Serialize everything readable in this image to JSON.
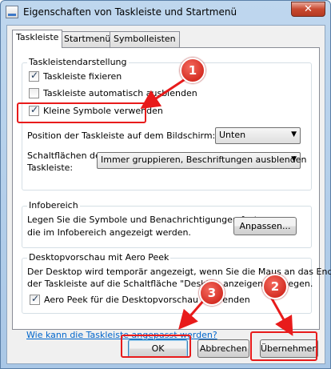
{
  "window": {
    "title": "Eigenschaften von Taskleiste und Startmenü",
    "close_label": "✕"
  },
  "tabs": [
    {
      "label": "Taskleiste",
      "active": true
    },
    {
      "label": "Startmenü",
      "active": false
    },
    {
      "label": "Symbolleisten",
      "active": false
    }
  ],
  "taskbar_group": {
    "title": "Taskleistendarstellung",
    "checkboxes": [
      {
        "label": "Taskleiste fixieren",
        "checked": true
      },
      {
        "label": "Taskleiste automatisch ausblenden",
        "checked": false
      },
      {
        "label": "Kleine Symbole verwenden",
        "checked": true
      }
    ],
    "position_label": "Position der Taskleiste auf dem Bildschirm:",
    "position_value": "Unten",
    "buttons_label_1": "Schaltflächen der",
    "buttons_label_2": "Taskleiste:",
    "buttons_value": "Immer gruppieren, Beschriftungen ausblenden"
  },
  "info_group": {
    "title": "Infobereich",
    "text_1": "Legen Sie die Symbole und Benachrichtigungen fest,",
    "text_2": "die im Infobereich angezeigt werden.",
    "customize_button": "Anpassen..."
  },
  "peek_group": {
    "title": "Desktopvorschau mit Aero Peek",
    "text_1": "Der Desktop wird temporär angezeigt, wenn Sie die Maus an das Ende",
    "text_2": "der Taskleiste auf die Schaltfläche \"Desktop anzeigen\" bewegen.",
    "checkbox_label": "Aero Peek für die Desktopvorschau verwenden",
    "checkbox_checked": true
  },
  "help_link": "Wie kann die Taskleiste angepasst werden?",
  "footer": {
    "ok": "OK",
    "cancel": "Abbrechen",
    "apply": "Übernehmen"
  },
  "annotations": {
    "badge_1": "1",
    "badge_2": "2",
    "badge_3": "3",
    "color": "#e81b1b"
  }
}
